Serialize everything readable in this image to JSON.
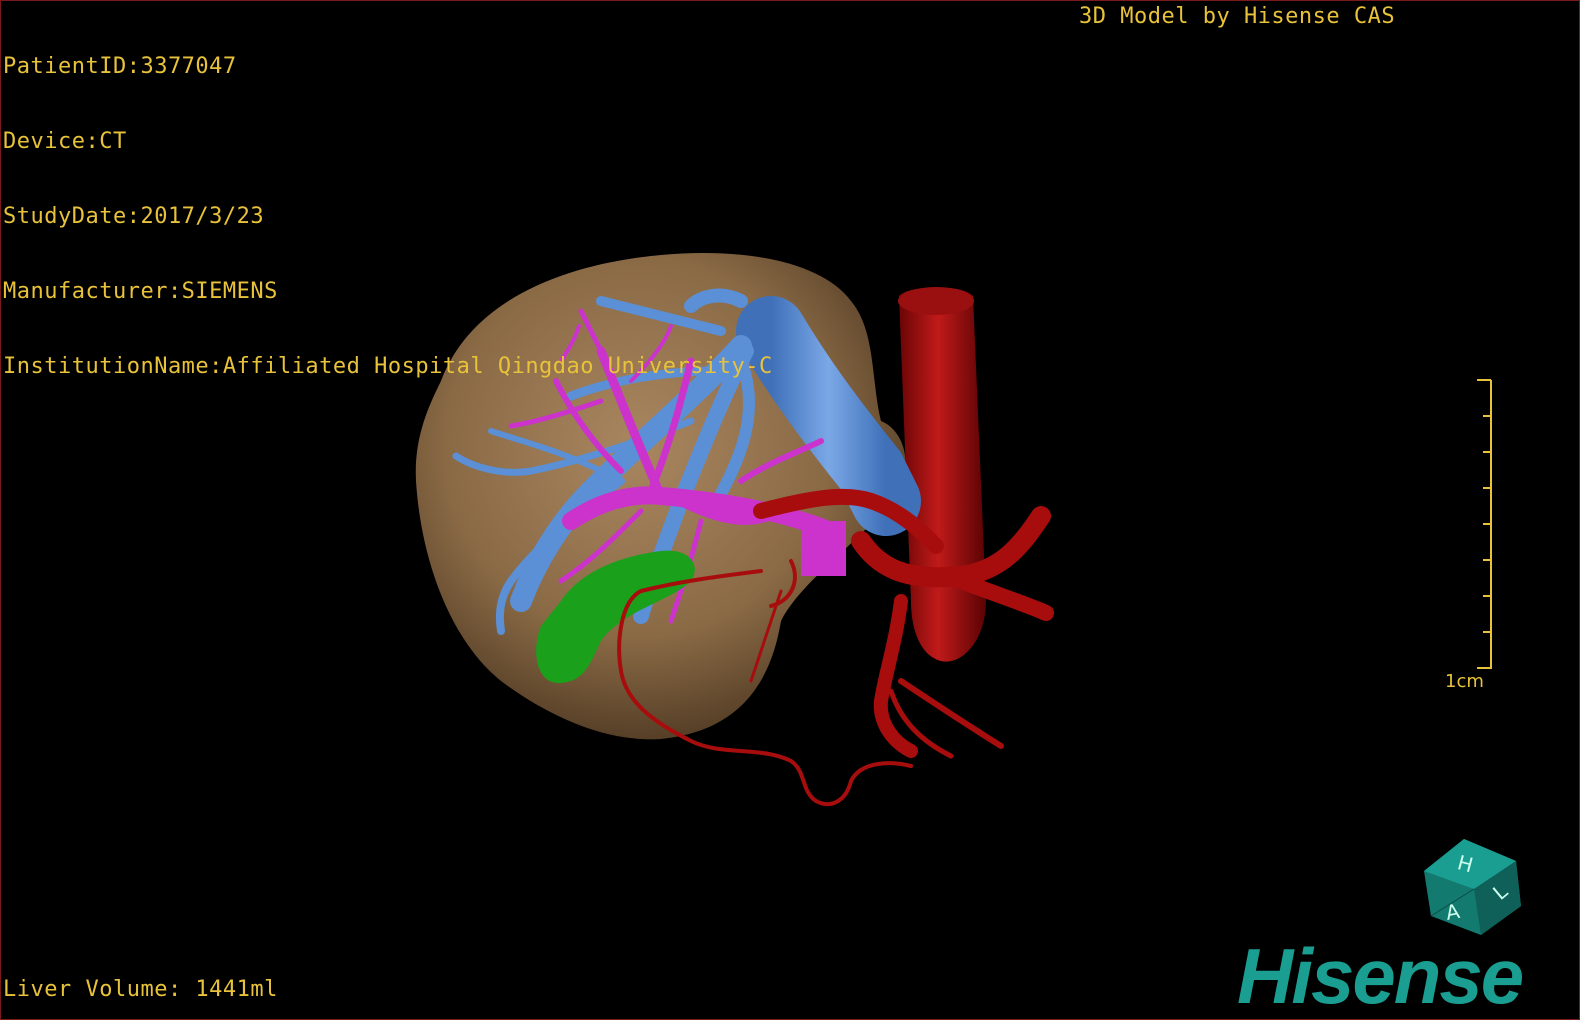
{
  "dicom": {
    "patient_id": "PatientID:3377047",
    "device": "Device:CT",
    "study_date": "StudyDate:2017/3/23",
    "manufacturer": "Manufacturer:SIEMENS",
    "institution": "InstitutionName:Affiliated Hospital Qingdao University-C"
  },
  "credit": "3D Model by Hisense CAS",
  "liver_volume": "Liver Volume: 1441ml",
  "scale_bar": {
    "label": "1cm"
  },
  "orientation_cube": {
    "labels": [
      "H",
      "L",
      "A"
    ]
  },
  "brand": "Hisense",
  "colors": {
    "text": "#e8c23a",
    "liver": "#8a6a45",
    "hepatic_vein": "#5b8fd6",
    "portal_vein": "#cc33cc",
    "gallbladder": "#1aa01a",
    "artery": "#a80d0d",
    "brand": "#1a9e91"
  }
}
